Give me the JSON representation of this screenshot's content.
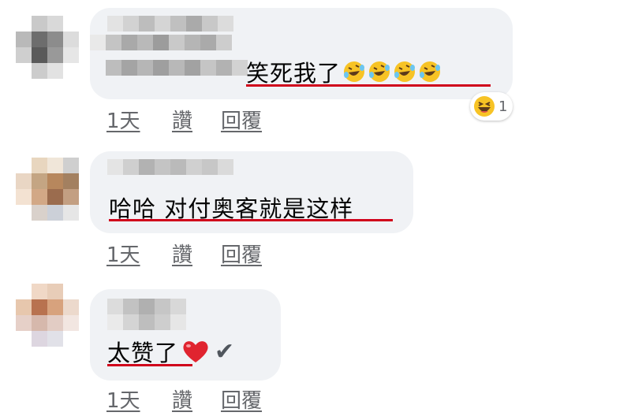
{
  "comments": [
    {
      "text": "笑死我了",
      "emoji": [
        "rofl-emoji",
        "rofl-emoji",
        "rofl-emoji",
        "rofl-emoji"
      ],
      "reaction": {
        "icon": "laughing-face-icon",
        "count": "1"
      },
      "actions": {
        "time": "1天",
        "like": "讚",
        "reply": "回覆"
      }
    },
    {
      "text": "哈哈 对付奥客就是这样",
      "actions": {
        "time": "1天",
        "like": "讚",
        "reply": "回覆"
      }
    },
    {
      "text": "太赞了",
      "emoji": [
        "red-heart-emoji",
        "check-mark-emoji"
      ],
      "actions": {
        "time": "1天",
        "like": "讚",
        "reply": "回覆"
      }
    }
  ],
  "colors": {
    "bubble": "#f0f2f5",
    "underline": "#d0021b",
    "meta": "#65676b"
  }
}
